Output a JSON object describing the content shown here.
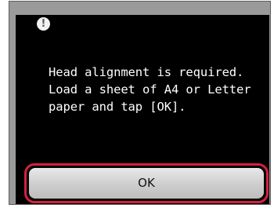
{
  "dialog": {
    "icon": "exclamation-icon",
    "message_lines": [
      "Head alignment is required.",
      "Load a sheet of A4 or Letter",
      "paper and tap [OK]."
    ]
  },
  "buttons": {
    "ok_label": "OK"
  },
  "colors": {
    "screen_background": "#000000",
    "frame": "#9a9a9a",
    "highlight": "#d4213d",
    "text": "#ffffff"
  }
}
